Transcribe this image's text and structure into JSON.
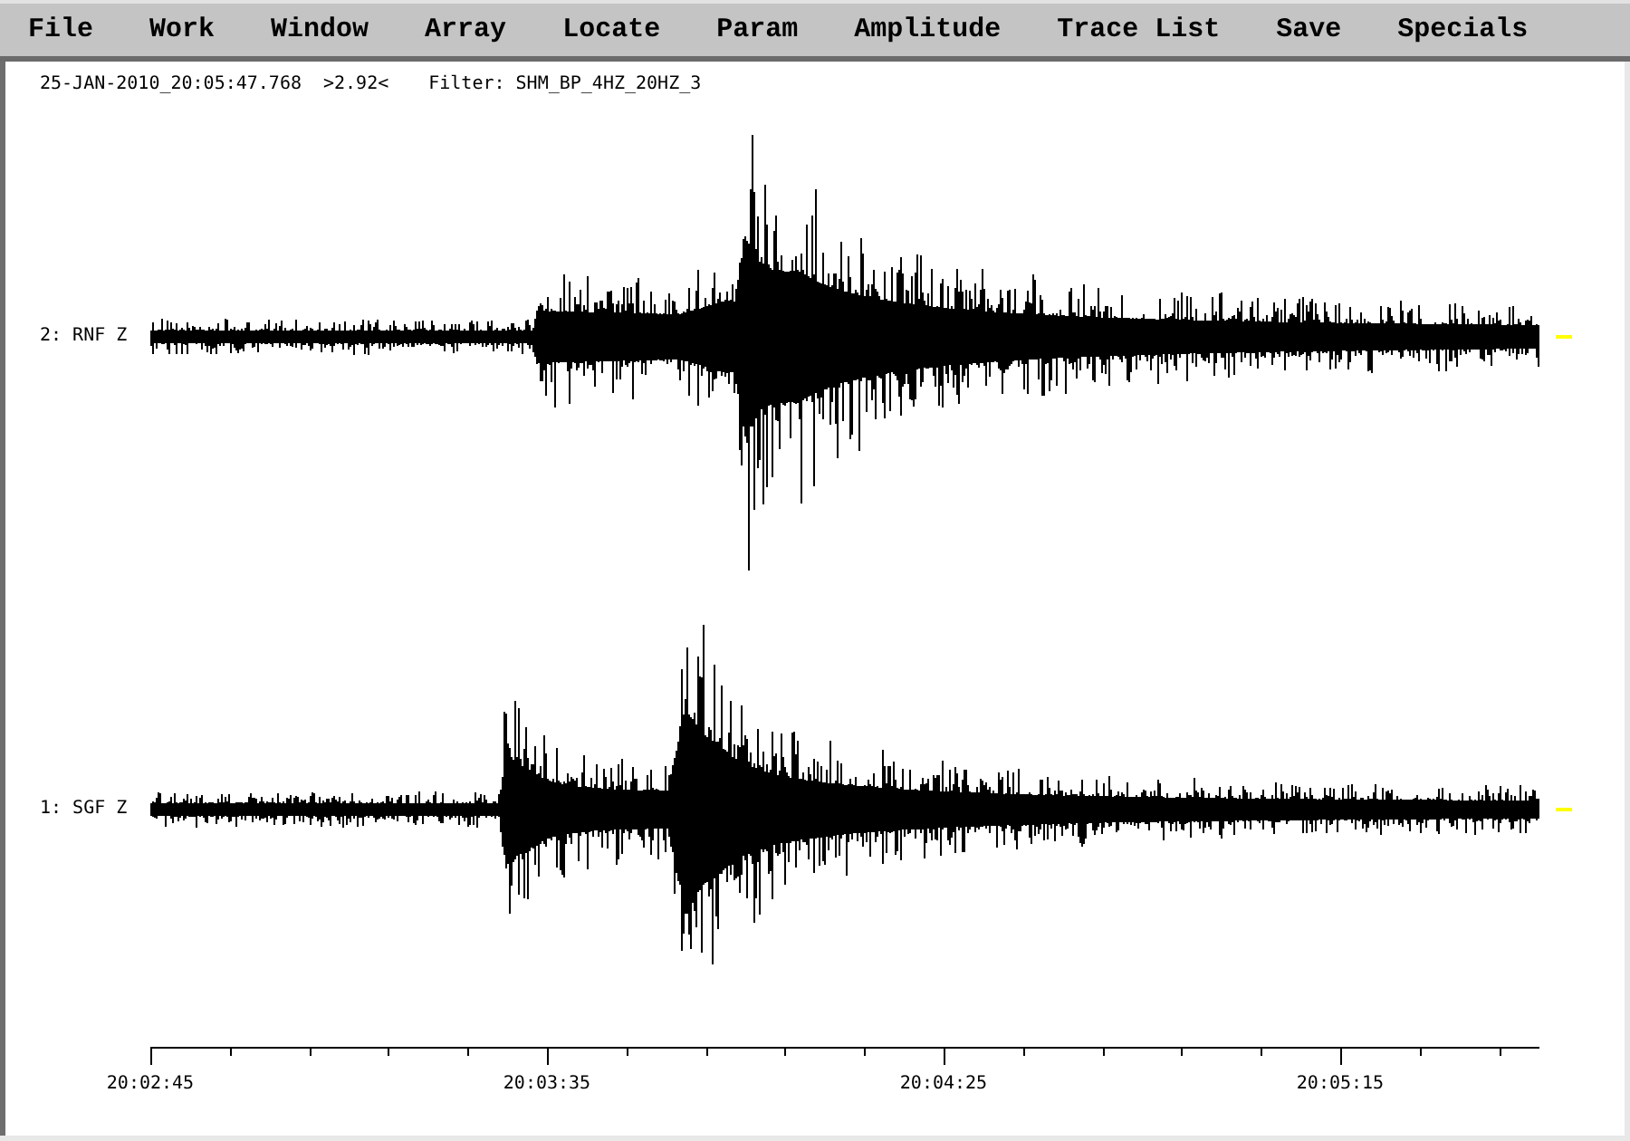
{
  "menu": [
    "File",
    "Work",
    "Window",
    "Array",
    "Locate",
    "Param",
    "Amplitude",
    "Trace List",
    "Save",
    "Specials"
  ],
  "header": {
    "timestamp": "25-JAN-2010_20:05:47.768",
    "reading": ">2.92<",
    "filter": "Filter: SHM_BP_4HZ_20HZ_3"
  },
  "traces": [
    {
      "label": "2: RNF Z"
    },
    {
      "label": "1: SGF Z"
    }
  ],
  "time_axis": {
    "tick_labels": [
      "20:02:45",
      "20:03:35",
      "20:04:25",
      "20:05:15"
    ]
  }
}
